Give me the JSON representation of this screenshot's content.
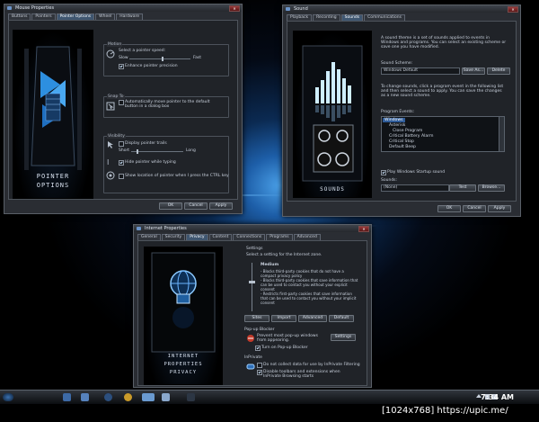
{
  "mouse_window": {
    "title": "Mouse Properties",
    "tabs": [
      "Buttons",
      "Pointers",
      "Pointer Options",
      "Wheel",
      "Hardware"
    ],
    "active_tab": "Pointer Options",
    "art_caption_line1": "POINTER",
    "art_caption_line2": "OPTIONS",
    "motion_group": "Motion",
    "speed_label": "Select a pointer speed:",
    "slow": "Slow",
    "fast": "Fast",
    "speed_level": 0.55,
    "enhance_precision": "Enhance pointer precision",
    "snap_group": "Snap To",
    "snap_text": "Automatically move pointer to the default button in a dialog box",
    "visibility_group": "Visibility",
    "trails_label": "Display pointer trails",
    "trails_short": "Short",
    "trails_long": "Long",
    "hide_typing": "Hide pointer while typing",
    "show_ctrl": "Show location of pointer when I press the CTRL key",
    "buttons": [
      "OK",
      "Cancel",
      "Apply"
    ]
  },
  "sound_window": {
    "title": "Sound",
    "tabs": [
      "Playback",
      "Recording",
      "Sounds",
      "Communications"
    ],
    "active_tab": "Sounds",
    "art_caption": "SOUNDS",
    "desc1": "A sound theme is a set of sounds applied to events in Windows and programs. You can select an existing scheme or save one you have modified.",
    "scheme_label": "Sound Scheme:",
    "scheme_value": "Windows Default",
    "save_as": "Save As...",
    "delete": "Delete",
    "desc2": "To change sounds, click a program event in the following list and then select a sound to apply. You can save the changes as a new sound scheme.",
    "events_label": "Program Events:",
    "events": [
      "Windows",
      "Asterisk",
      "Close Program",
      "Critical Battery Alarm",
      "Critical Stop",
      "Default Beep"
    ],
    "selected_event": 0,
    "play_startup": "Play Windows Startup sound",
    "sounds_label": "Sounds:",
    "sounds_value": "(None)",
    "test": "Test",
    "browse": "Browse...",
    "buttons": [
      "OK",
      "Cancel",
      "Apply"
    ]
  },
  "inet_window": {
    "title": "Internet Properties",
    "tabs": [
      "General",
      "Security",
      "Privacy",
      "Content",
      "Connections",
      "Programs",
      "Advanced"
    ],
    "active_tab": "Privacy",
    "art_line1": "INTERNET",
    "art_line2": "PROPERTIES",
    "art_line3": "PRIVACY",
    "settings_group": "Settings",
    "settings_text": "Select a setting for the Internet zone.",
    "level_name": "Medium",
    "level_desc": "- Blocks third-party cookies that do not have a compact privacy policy\n- Blocks third-party cookies that save information that can be used to contact you without your explicit consent\n- Restricts first-party cookies that save information that can be used to contact you without your implicit consent",
    "sites": "Sites",
    "import": "Import",
    "advanced": "Advanced",
    "default": "Default",
    "popup_group": "Pop-up Blocker",
    "popup_text": "Prevent most pop-up windows from appearing.",
    "popup_settings": "Settings",
    "popup_check": "Turn on Pop-up Blocker",
    "inprivate_group": "InPrivate",
    "inprivate1": "Do not collect data for use by InPrivate Filtering",
    "inprivate2": "Disable toolbars and extensions when InPrivate Browsing starts"
  },
  "taskbar": {
    "clock": "7:34 AM"
  },
  "watermark": "[1024x768] https://upic.me/"
}
